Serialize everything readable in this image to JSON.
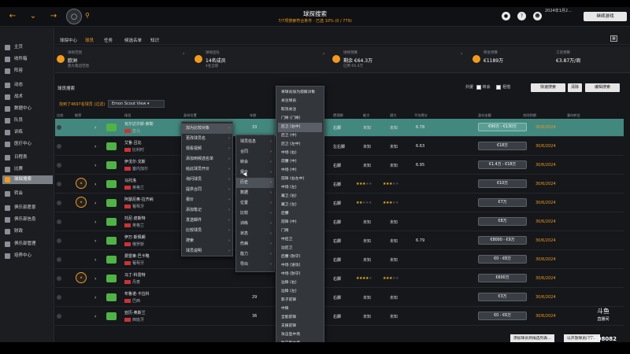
{
  "topbar": {
    "title": "球探搜索",
    "subtitle": "7/7项搜索符合条件 · 已选 10% (0 / 779)",
    "date_line1": "2024年1月2...",
    "date_line2": "",
    "continue_label": "继续游戏"
  },
  "sidebar": {
    "items": [
      {
        "label": "主页"
      },
      {
        "label": "收件箱"
      },
      {
        "label": "阵容"
      },
      {
        "label": "动态"
      },
      {
        "label": "战术"
      },
      {
        "label": "数据中心"
      },
      {
        "label": "队员"
      },
      {
        "label": "训练"
      },
      {
        "label": "医疗中心"
      },
      {
        "label": "日程表"
      },
      {
        "label": "比赛"
      },
      {
        "label": "球探搜索",
        "active": true
      },
      {
        "label": "转会"
      },
      {
        "label": "俱乐部愿景"
      },
      {
        "label": "俱乐部信息"
      },
      {
        "label": "财政"
      },
      {
        "label": "俱乐部管理"
      },
      {
        "label": "培养中心"
      }
    ]
  },
  "subnav": {
    "items": [
      "球探中心",
      "球员",
      "任务",
      "候选名单",
      "知识"
    ],
    "current_index": 1
  },
  "info": {
    "blocks": [
      {
        "label": "球探范围",
        "value": "欧洲",
        "sub": "图大集团范围"
      },
      {
        "label": "球探团队",
        "value": "14名成员",
        "sub": "4名全职"
      },
      {
        "label": "球探预算",
        "value": "剩余 €64.3万",
        "sub": "已用 €6.4万"
      },
      {
        "label": "转会预算",
        "value": "€1189万",
        "sub": ""
      },
      {
        "label": "工资预算",
        "value": "€3.87万/周",
        "sub": ""
      }
    ]
  },
  "players_header": {
    "title": "球员搜索",
    "opt_label": "外援",
    "opt1": "转会",
    "opt2": "租借",
    "quick_btn": "快速搜索",
    "clear_btn": "清除",
    "edit_btn": "编辑搜索"
  },
  "filters": {
    "count_text": "找到了4697名球员 (过滤)",
    "view_label": "Emon Scout View"
  },
  "columns": [
    "比较",
    "推荐",
    "球员",
    "身份位置",
    "年龄",
    "位置",
    "惯用脚",
    "能力",
    "潜力",
    "平均得分",
    "身价金额",
    "合同到期",
    "意向转会"
  ],
  "players": [
    {
      "name": "瓦尔达尔斯·索勒",
      "club": "皇马",
      "age": "33",
      "foot": "右脚",
      "ability": "未知",
      "potential": "未知",
      "rating": "6.78",
      "value": "€90万 - €130万",
      "contract": "30/6/2024",
      "stars_a": 0,
      "stars_p": 0
    },
    {
      "name": "艾鲁·吕比",
      "club": "比利时",
      "age": "31",
      "foot": "左右脚",
      "ability": "未知",
      "potential": "未知",
      "rating": "6.63",
      "value": "€18万",
      "contract": "30/6/2024",
      "stars_a": 0,
      "stars_p": 0
    },
    {
      "name": "伊戈尔·戈斯",
      "club": "塞内加尔",
      "age": "",
      "foot": "右脚",
      "ability": "未知",
      "potential": "未知",
      "rating": "6.95",
      "value": "€1.4万 - €18万",
      "contract": "30/6/2024",
      "stars_a": 0,
      "stars_p": 0
    },
    {
      "name": "马托洛",
      "club": "英格兰",
      "age": "",
      "foot": "右脚",
      "ability": "",
      "potential": "",
      "rating": "",
      "value": "€10万",
      "contract": "30/6/2024",
      "stars_a": 3,
      "stars_p": 3
    },
    {
      "name": "阿瑟尼奥·拉齐纳",
      "club": "葡萄牙",
      "age": "",
      "foot": "右脚",
      "ability": "",
      "potential": "",
      "rating": "",
      "value": "€7万",
      "contract": "30/6/2024",
      "stars_a": 2,
      "stars_p": 3
    },
    {
      "name": "托尼·皮斯特",
      "club": "英格兰",
      "age": "",
      "foot": "右脚",
      "ability": "未知",
      "potential": "未知",
      "rating": "",
      "value": "€8万",
      "contract": "30/6/2024",
      "stars_a": 0,
      "stars_p": 0
    },
    {
      "name": "伊万·斯佩朗",
      "club": "俄罗斯",
      "age": "",
      "foot": "右脚",
      "ability": "未知",
      "potential": "未知",
      "rating": "6.79",
      "value": "€8000 - €9万",
      "contract": "30/6/2024",
      "stars_a": 0,
      "stars_p": 0
    },
    {
      "name": "费雷莱·巴卡略",
      "club": "葡萄牙",
      "age": "10",
      "foot": "右脚",
      "ability": "未知",
      "potential": "未知",
      "rating": "",
      "value": "€0 - €8万",
      "contract": "30/6/2024",
      "stars_a": 0,
      "stars_p": 0
    },
    {
      "name": "马丁·科雷特",
      "club": "丹麦",
      "age": "",
      "foot": "右脚",
      "ability": "",
      "potential": "",
      "rating": "",
      "value": "€600万",
      "contract": "30/6/2024",
      "stars_a": 4,
      "stars_p": 3
    },
    {
      "name": "布鲁诺·卡拉科",
      "club": "巴西",
      "age": "29",
      "foot": "右脚",
      "ability": "未知",
      "potential": "未知",
      "rating": "",
      "value": "€3万",
      "contract": "30/6/2024",
      "stars_a": 0,
      "stars_p": 0
    },
    {
      "name": "亚历·奥斯兰",
      "club": "西班牙",
      "age": "36",
      "foot": "右脚",
      "ability": "未知",
      "potential": "未知",
      "rating": "",
      "value": "€0 - €6万",
      "contract": "30/6/2024",
      "stars_a": 0,
      "stars_p": 0
    }
  ],
  "menu1": {
    "items": [
      "加为比较对象",
      "更改球员名",
      "观看视频",
      "添加到候选名单",
      "给此球员开价",
      "询问球员",
      "提供合同",
      "报价",
      "添加笔记",
      "发送邮件",
      "比较球员",
      "搜索",
      "球员说明"
    ],
    "highlight": 0
  },
  "menu2": {
    "items": [
      "球员信息",
      "合同",
      "转会",
      "报价",
      "历史",
      "数据",
      "位置",
      "比较",
      "训练",
      "状态",
      "伤病",
      "能力",
      "导出"
    ],
    "highlight": 4
  },
  "menu3": {
    "items": [
      "将球员加为观察对象",
      "关注球员",
      "取消关注",
      "门将 (门将)",
      "后卫 (右中)",
      "后卫 (中)",
      "后卫 (左中)",
      "中场 (右)",
      "前腰 (中)",
      "中场 (中)",
      "前锋 (右左中)",
      "中场 (左)",
      "翼卫 (右)",
      "翼卫 (左)",
      "后腰",
      "前锋 (中)",
      "门将",
      "中后卫",
      "边后卫",
      "后腰 (防守)",
      "中场 (进攻)",
      "中场 (防守)",
      "边锋 (右)",
      "边锋 (左)",
      "影子前锋",
      "中锋",
      "全能前锋",
      "支援前锋",
      "攻击型中场",
      "防守型中场"
    ],
    "highlight": 4
  },
  "overlay": {
    "watermark": "斗鱼",
    "watermark_sub": "直播间",
    "room": "10298082",
    "toast1": "添加球员到候选列表...",
    "toast2": "以开放球员搜索..."
  }
}
